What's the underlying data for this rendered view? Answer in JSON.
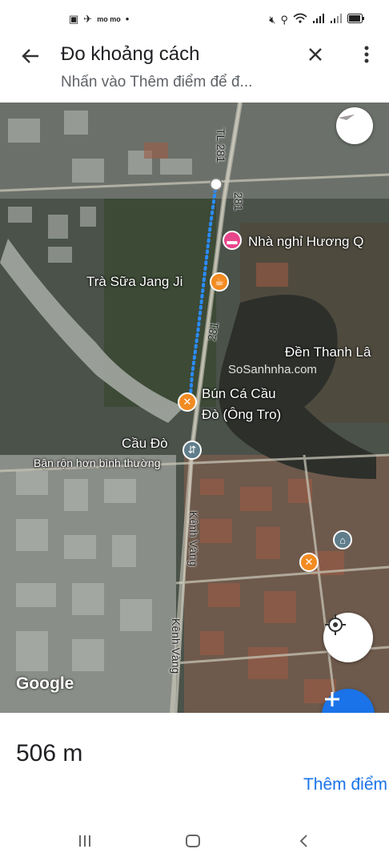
{
  "status_bar": {
    "left_icons": [
      "▣",
      "✈",
      "mo mo",
      "•"
    ],
    "right_icons": [
      "mute-icon",
      "location-icon",
      "wifi-icon",
      "signal-icon",
      "signal-icon",
      "battery-icon"
    ]
  },
  "header": {
    "title": "Đo khoảng cách",
    "subtitle": "Nhấn vào Thêm điểm để đ..."
  },
  "map": {
    "labels": {
      "nha_nghi": "Nhà nghỉ Hương Q",
      "tra_sua": "Trà Sữa Jang Ji",
      "den": "Đền Thanh Lâ",
      "bun_ca": "Bún Cá Cầu",
      "bun_ca_2": "Đò (Ông Tro)",
      "cau_do": "Cầu Đò",
      "busy": "Bận rộn hơn bình thường",
      "kenh_vang_1": "Kênh Vàng",
      "kenh_vang_2": "Kênh Vàng",
      "tl281": "TL 281",
      "r281a": "281",
      "r281b": "281",
      "google": "Google",
      "watermark": "SoSanhnha.com"
    },
    "colors": {
      "route": "#2a8cff",
      "hotel": "#e8458b",
      "food": "#f28b22",
      "attraction": "#607d8b"
    }
  },
  "bottom": {
    "distance": "506 m",
    "add_point": "Thêm điểm"
  }
}
